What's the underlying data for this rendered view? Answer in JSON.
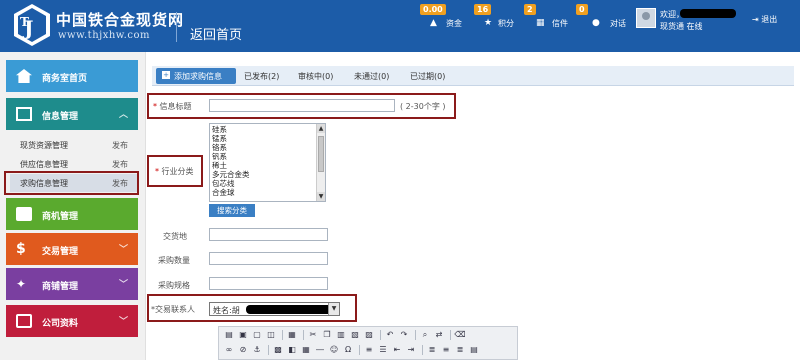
{
  "header": {
    "logo_cn": "中国铁合金现货网",
    "logo_url": "www.thjxhw.com",
    "home_link": "返回首页",
    "stats": [
      {
        "badge": "0.00",
        "label": "资金",
        "icon": "wallet-icon"
      },
      {
        "badge": "16",
        "label": "积分",
        "icon": "star-icon"
      },
      {
        "badge": "2",
        "label": "积分",
        "icon": "points-icon"
      },
      {
        "badge": "0",
        "label": "信件",
        "icon": "mail-icon"
      }
    ],
    "stats_labels": [
      "资金",
      "积分",
      "信件",
      "对话"
    ],
    "chat_label": "对话",
    "greeting": "欢迎，",
    "user_status": "现货通  在线",
    "logout": "退出"
  },
  "sidebar": {
    "menus": [
      {
        "label": "商务室首页",
        "color": "#3a9bd5",
        "icon": "home-icon"
      },
      {
        "label": "信息管理",
        "color": "#1e8c8c",
        "icon": "info-icon"
      },
      {
        "label": "商机管理",
        "color": "#5aaa2e",
        "icon": "opportunity-icon"
      },
      {
        "label": "交易管理",
        "color": "#e05a1e",
        "icon": "money-icon"
      },
      {
        "label": "商铺管理",
        "color": "#7a3fa0",
        "icon": "wand-icon"
      },
      {
        "label": "公司资料",
        "color": "#c01e3c",
        "icon": "company-icon"
      }
    ],
    "sub_items": [
      {
        "label": "现货资源管理",
        "action": "发布"
      },
      {
        "label": "供应信息管理",
        "action": "发布"
      },
      {
        "label": "求购信息管理",
        "action": "发布"
      }
    ]
  },
  "tabs": {
    "active": "添加求购信息",
    "items": [
      "已发布(2)",
      "审核中(0)",
      "未通过(0)",
      "已过期(0)"
    ]
  },
  "form": {
    "title_label": "信息标题",
    "title_hint": "( 2-30个字 )",
    "industry_label": "行业分类",
    "industry_options": [
      "硅系",
      "锰系",
      "铬系",
      "钒系",
      "稀土",
      "多元合金类",
      "包芯线",
      "合金球"
    ],
    "search_category": "搜索分类",
    "delivery_label": "交货地",
    "quantity_label": "采购数量",
    "spec_label": "采购规格",
    "contact_label": "*交易联系人",
    "contact_value": "姓名:胡"
  },
  "colors": {
    "header_bg": "#1c5ca8",
    "badge": "#f0a020",
    "accent": "#3a7fc4",
    "annotation": "#8b1a1a"
  }
}
